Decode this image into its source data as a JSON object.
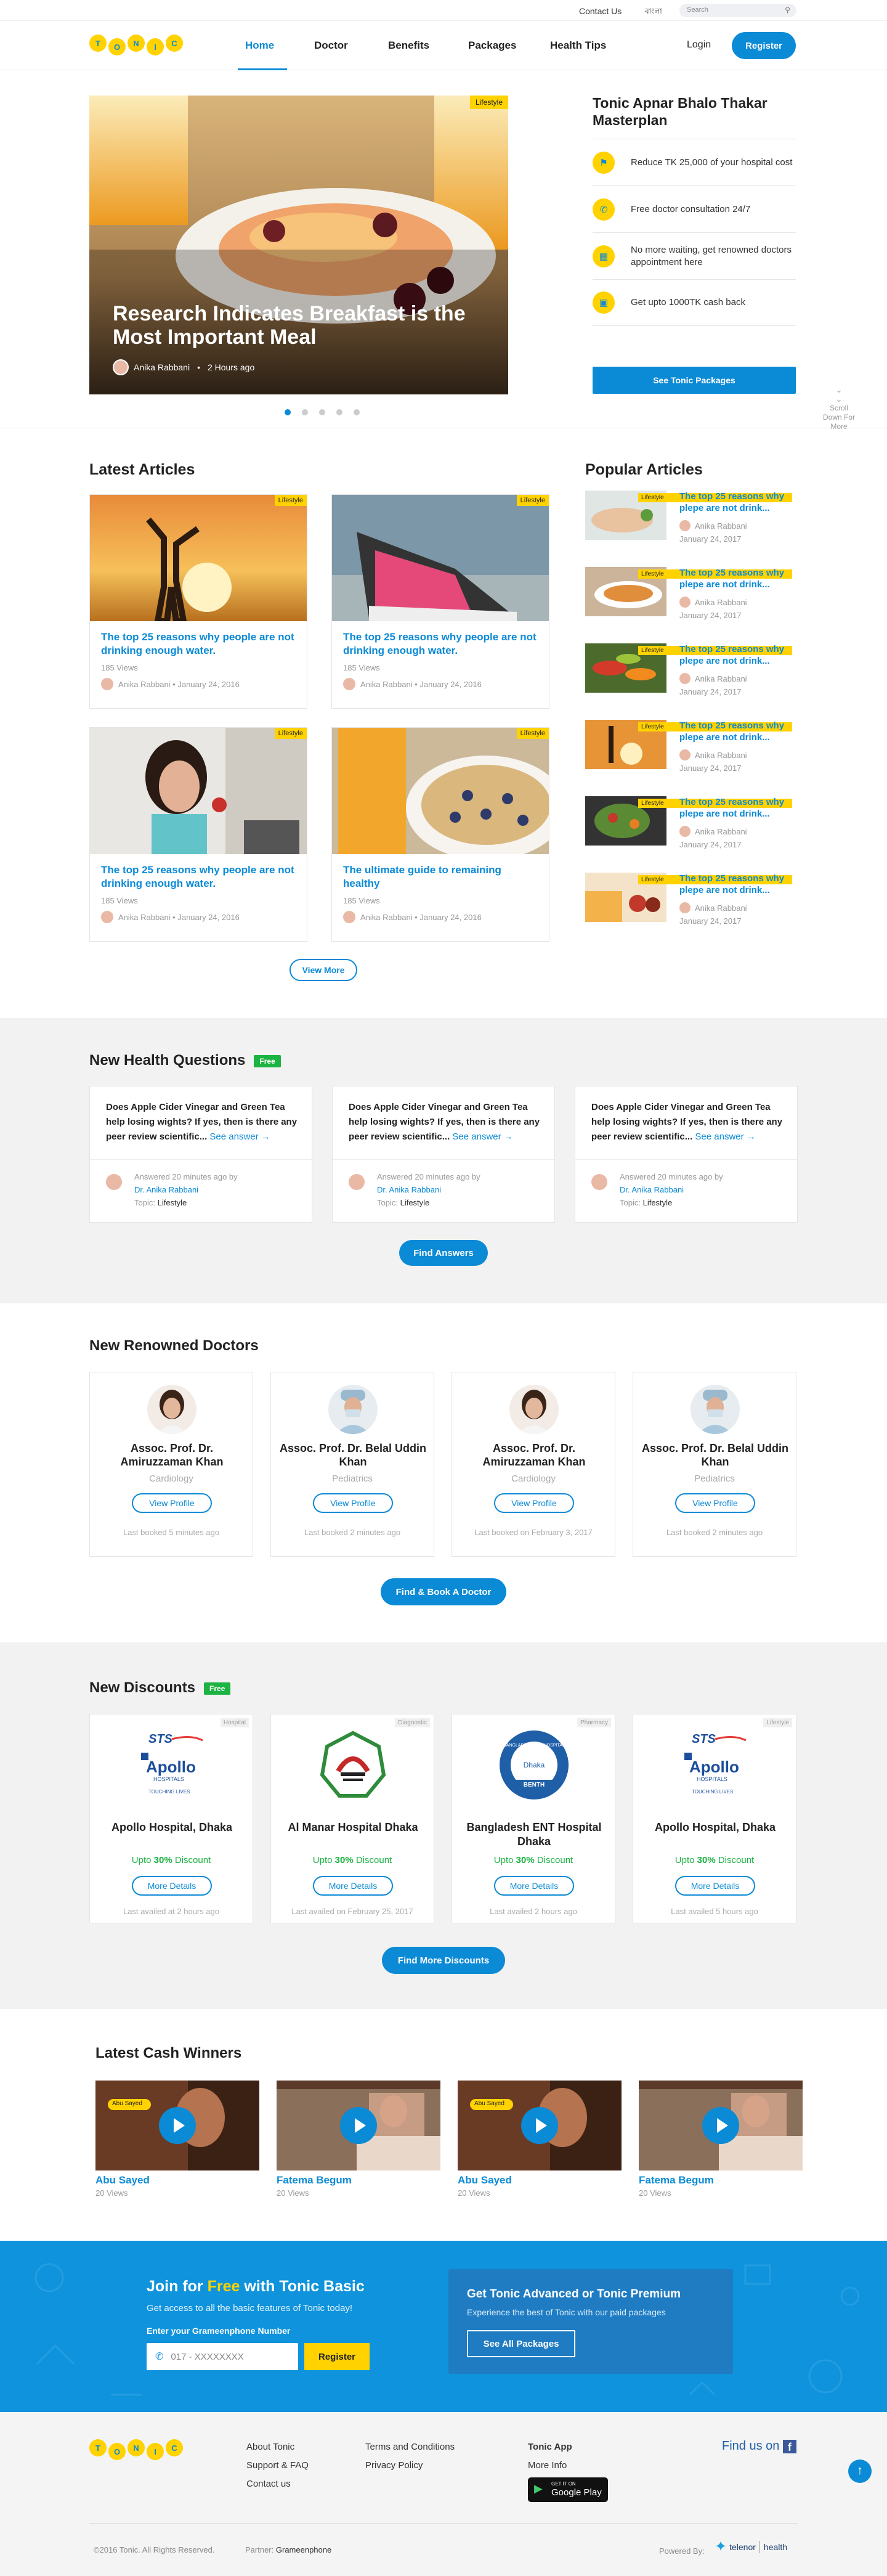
{
  "topbar": {
    "contact": "Contact Us",
    "lang": "বাংলা",
    "search_placeholder": "Search"
  },
  "brand": {
    "letters": [
      "T",
      "O",
      "N",
      "I",
      "C"
    ]
  },
  "nav": {
    "items": [
      "Home",
      "Doctor",
      "Benefits",
      "Packages",
      "Health Tips"
    ],
    "login": "Login",
    "register": "Register"
  },
  "hero": {
    "badge": "Lifestyle",
    "title": "Research Indicates Breakfast is the Most Important Meal",
    "author": "Anika Rabbani",
    "time": "2 Hours ago",
    "side_title": "Tonic  Apnar Bhalo Thakar Masterplan",
    "features": [
      "Reduce TK 25,000 of your hospital cost",
      "Free doctor consultation 24/7",
      "No more waiting, get renowned doctors appointment here",
      "Get upto 1000TK cash back"
    ],
    "cta": "See Tonic Packages",
    "scroll": "Scroll Down For More"
  },
  "latest": {
    "title": "Latest Articles",
    "cards": [
      {
        "badge": "Lifestyle",
        "title": "The top 25 reasons why people are not drinking enough water.",
        "views": "185 Views",
        "author": "Anika Rabbani",
        "date": "January 24, 2016"
      },
      {
        "badge": "Lifestyle",
        "title": "The top 25 reasons why people are not drinking enough water.",
        "views": "185 Views",
        "author": "Anika Rabbani",
        "date": "January 24, 2016"
      },
      {
        "badge": "Lifestyle",
        "title": "The top 25 reasons why people are not drinking enough water.",
        "views": "185 Views",
        "author": "Anika Rabbani",
        "date": "January 24, 2016"
      },
      {
        "badge": "Lifestyle",
        "title": "The ultimate guide to remaining healthy",
        "views": "185 Views",
        "author": "Anika Rabbani",
        "date": "January 24, 2016"
      }
    ],
    "more": "View More"
  },
  "popular": {
    "title": "Popular Articles",
    "items": [
      {
        "badge": "Lifestyle",
        "title": "The top 25 reasons why plepe are not drink...",
        "author": "Anika Rabbani",
        "date": "January 24, 2017"
      },
      {
        "badge": "Lifestyle",
        "title": "The top 25 reasons why plepe are not drink...",
        "author": "Anika Rabbani",
        "date": "January 24, 2017"
      },
      {
        "badge": "Lifestyle",
        "title": "The top 25 reasons why plepe are not drink...",
        "author": "Anika Rabbani",
        "date": "January 24, 2017"
      },
      {
        "badge": "Lifestyle",
        "title": "The top 25 reasons why plepe are not drink...",
        "author": "Anika Rabbani",
        "date": "January 24, 2017"
      },
      {
        "badge": "Lifestyle",
        "title": "The top 25 reasons why plepe are not drink...",
        "author": "Anika Rabbani",
        "date": "January 24, 2017"
      },
      {
        "badge": "Lifestyle",
        "title": "The top 25 reasons why plepe are not drink...",
        "author": "Anika Rabbani",
        "date": "January 24, 2017"
      }
    ]
  },
  "questions": {
    "title": "New Health Questions",
    "free": "Free",
    "items": [
      {
        "q": "Does Apple Cider Vinegar and Green Tea help losing wights? If yes, then is there any peer review scientific...",
        "link": "See answer →",
        "ans": "Answered 20 minutes ago by",
        "doc": "Dr. Anika Rabbani",
        "topic_label": "Topic:",
        "topic": "Lifestyle"
      },
      {
        "q": "Does Apple Cider Vinegar and Green Tea help losing wights? If yes, then is there any peer review scientific...",
        "link": "See answer →",
        "ans": "Answered 20 minutes ago by",
        "doc": "Dr. Anika Rabbani",
        "topic_label": "Topic:",
        "topic": "Lifestyle"
      },
      {
        "q": "Does Apple Cider Vinegar and Green Tea help losing wights? If yes, then is there any peer review scientific...",
        "link": "See answer →",
        "ans": "Answered 20 minutes ago by",
        "doc": "Dr. Anika Rabbani",
        "topic_label": "Topic:",
        "topic": "Lifestyle"
      }
    ],
    "cta": "Find Answers"
  },
  "doctors": {
    "title": "New Renowned Doctors",
    "items": [
      {
        "name": "Assoc. Prof. Dr. Amiruzzaman Khan",
        "spec": "Cardiology",
        "btn": "View Profile",
        "last": "Last booked 5 minutes ago"
      },
      {
        "name": "Assoc. Prof. Dr. Belal Uddin Khan",
        "spec": "Pediatrics",
        "btn": "View Profile",
        "last": "Last booked 2 minutes ago"
      },
      {
        "name": "Assoc. Prof. Dr. Amiruzzaman Khan",
        "spec": "Cardiology",
        "btn": "View Profile",
        "last": "Last booked on February 3, 2017"
      },
      {
        "name": "Assoc. Prof. Dr. Belal Uddin Khan",
        "spec": "Pediatrics",
        "btn": "View Profile",
        "last": "Last booked 2 minutes ago"
      }
    ],
    "cta": "Find & Book A Doctor"
  },
  "discounts": {
    "title": "New Discounts",
    "free": "Free",
    "items": [
      {
        "tag": "Hospital",
        "name": "Apollo Hospital, Dhaka",
        "pre": "Upto ",
        "pct": "30%",
        "post": " Discount",
        "btn": "More Details",
        "last": "Last availed at 2 hours ago",
        "logo": "apollo"
      },
      {
        "tag": "Diagnostic",
        "name": "Al Manar Hospital Dhaka",
        "pre": "Upto ",
        "pct": "30%",
        "post": " Discount",
        "btn": "More Details",
        "last": "Last availed on February 25, 2017",
        "logo": "almanar"
      },
      {
        "tag": "Pharmacy",
        "name": "Bangladesh ENT Hospital Dhaka",
        "pre": "Upto ",
        "pct": "30%",
        "post": " Discount",
        "btn": "More Details",
        "last": "Last availed 2 hours ago",
        "logo": "ent"
      },
      {
        "tag": "Lifestyle",
        "name": "Apollo Hospital, Dhaka",
        "pre": "Upto ",
        "pct": "30%",
        "post": " Discount",
        "btn": "More Details",
        "last": "Last availed 5 hours ago",
        "logo": "apollo"
      }
    ],
    "cta": "Find More Discounts",
    "logo_text": {
      "sts": "STS",
      "apollo": "Apollo",
      "apollo_sub": "HOSPITALS",
      "apollo_tag": "TOUCHING LIVES",
      "ent_ring": "BANGLADESH ENT HOSPITAL",
      "ent_center": "Dhaka",
      "ent_band": "BENTH"
    }
  },
  "winners": {
    "title": "Latest Cash Winners",
    "items": [
      {
        "name": "Abu Sayed",
        "views": "20 Views",
        "cap": "Abu Sayed"
      },
      {
        "name": "Fatema Begum",
        "views": "20 Views",
        "cap": ""
      },
      {
        "name": "Abu Sayed",
        "views": "20 Views",
        "cap": "Abu Sayed"
      },
      {
        "name": "Fatema Begum",
        "views": "20 Views",
        "cap": ""
      }
    ]
  },
  "promo": {
    "join_pre": "Join for ",
    "join_free": "Free",
    "join_post": " with Tonic Basic",
    "sub": "Get access to all the basic features of Tonic today!",
    "label": "Enter your Grameenphone Number",
    "placeholder": "017 - XXXXXXXX",
    "register": "Register",
    "adv_title": "Get Tonic Advanced or Tonic Premium",
    "adv_sub": "Experience the best of Tonic with our paid packages",
    "adv_btn": "See All Packages"
  },
  "footer": {
    "col1": [
      "About Tonic",
      "Support & FAQ",
      "Contact us"
    ],
    "col2": [
      "Terms and Conditions",
      "Privacy Policy"
    ],
    "app_title": "Tonic App",
    "more_info": "More Info",
    "store_small": "GET IT ON",
    "store_big": "Google Play",
    "find_us": "Find us on",
    "copyright": "©2016 Tonic. All Rights Reserved.",
    "partner_label": "Partner:",
    "partner": "Grameenphone",
    "powered": "Powered By:",
    "telenor": "telenor",
    "health": "health"
  },
  "colors": {
    "brand_blue": "#0b8ad6",
    "brand_yellow": "#ffd200",
    "free_green": "#1bb341"
  }
}
